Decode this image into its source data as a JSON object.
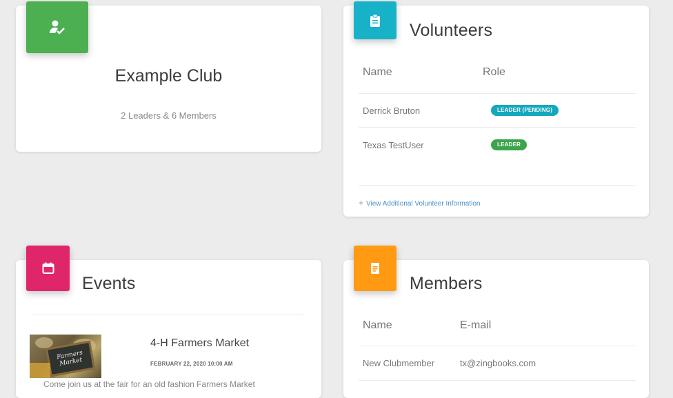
{
  "colors": {
    "green": "#4caf50",
    "cyan": "#17b2c8",
    "pink": "#e0266b",
    "orange": "#ff9a12",
    "badge_cyan": "#14a8be",
    "badge_green": "#3ca44a",
    "link": "#4a90c8"
  },
  "club_card": {
    "icon": "person-check-icon",
    "name": "Example Club",
    "summary": "2 Leaders & 6 Members"
  },
  "volunteers_card": {
    "icon": "clipboard-icon",
    "title": "Volunteers",
    "columns": {
      "name": "Name",
      "role": "Role"
    },
    "rows": [
      {
        "name": "Derrick Bruton",
        "role": "LEADER (PENDING)"
      },
      {
        "name": "Texas TestUser",
        "role": "LEADER"
      }
    ],
    "link_icon": "plus-icon",
    "link_text": "View Additional Volunteer Information"
  },
  "events_card": {
    "icon": "calendar-icon",
    "title": "Events",
    "event": {
      "image_text": "Farmers Market",
      "title": "4-H Farmers Market",
      "date": "FEBRUARY 22, 2020 10:00 AM",
      "description": "Come join us at the fair for an old fashion Farmers Market"
    }
  },
  "members_card": {
    "icon": "clipboard-icon",
    "title": "Members",
    "columns": {
      "name": "Name",
      "email": "E-mail"
    },
    "rows": [
      {
        "name": "New Clubmember",
        "email": "tx@zingbooks.com"
      }
    ]
  }
}
